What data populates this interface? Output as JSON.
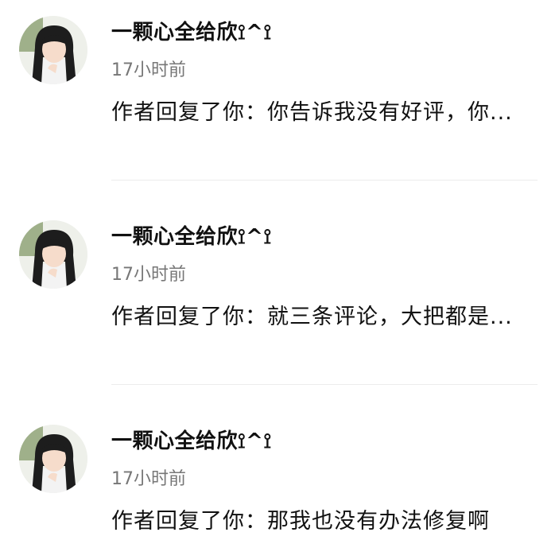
{
  "notifications": [
    {
      "username": "一颗心全给欣⟟^⟟",
      "time": "17小时前",
      "content": "作者回复了你：你告诉我没有好评，你..."
    },
    {
      "username": "一颗心全给欣⟟^⟟",
      "time": "17小时前",
      "content": "作者回复了你：就三条评论，大把都是..."
    },
    {
      "username": "一颗心全给欣⟟^⟟",
      "time": "17小时前",
      "content": "作者回复了你：那我也没有办法修复啊"
    }
  ]
}
